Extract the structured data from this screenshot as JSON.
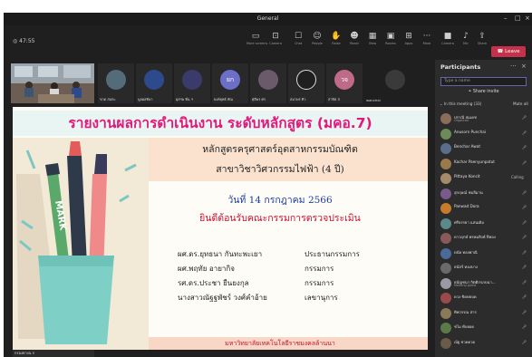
{
  "window": {
    "title": "General"
  },
  "toolbar": {
    "timer": "47:55",
    "buttons": [
      {
        "icon": "screen-icon",
        "label": "More screens"
      },
      {
        "icon": "camera-icon",
        "label": "Camera"
      },
      {
        "icon": "chat-icon",
        "label": "Chat"
      },
      {
        "icon": "people-icon",
        "label": "People"
      },
      {
        "icon": "raise-hand-icon",
        "label": "Raise"
      },
      {
        "icon": "react-icon",
        "label": "React"
      },
      {
        "icon": "view-icon",
        "label": "View"
      },
      {
        "icon": "rooms-icon",
        "label": "Rooms"
      },
      {
        "icon": "apps-icon",
        "label": "Apps"
      },
      {
        "icon": "more-icon",
        "label": "More"
      },
      {
        "icon": "camera-off-icon",
        "label": "Camera"
      },
      {
        "icon": "mic-icon",
        "label": "Mic"
      },
      {
        "icon": "share-icon",
        "label": "Share"
      }
    ],
    "leave_label": "Leave"
  },
  "video_tiles": [
    {
      "name": "ขวด สบตะ",
      "avatar_text": ""
    },
    {
      "name": "พูลผลทิพา",
      "avatar_text": ""
    },
    {
      "name": "ผุสฯพ ทิ่น ฯ",
      "avatar_text": ""
    },
    {
      "name": "ยงค์ยุทธ์ ทัณ",
      "avatar_text": "ยก"
    },
    {
      "name": "ศุลีพร ศร",
      "avatar_text": ""
    },
    {
      "name": "สมาพร ทิว",
      "avatar_text": ""
    },
    {
      "name": "สาธิต ส",
      "avatar_text": "วจ"
    },
    {
      "name": "wanchai",
      "avatar_text": ""
    }
  ],
  "slide": {
    "title": "รายงานผลการดำเนินงาน ระดับหลักสูตร (มคอ.7)",
    "line1": "หลักสูตรครุศาสตร์อุตสาหกรรมบัณฑิต",
    "line2": "สาขาวิชาวิศวกรรมไฟฟ้า (4 ปี)",
    "date": "วันที่ 14 กรกฎาคม 2566",
    "welcome": "ยินดีต้อนรับคณะกรรมการตรวจประเมิน",
    "committee": [
      {
        "name": "ผศ.ดร.ยุทธนา กันทะพะเยา",
        "role": "ประธานกรรมการ"
      },
      {
        "name": "ผศ.พฤทัย อายากิจ",
        "role": "กรรมการ"
      },
      {
        "name": "รศ.ดร.ประชา ยืนยงกุล",
        "role": "กรรมการ"
      },
      {
        "name": "นางสาวณัฐฐพัชร์ วงศ์คำอ้าย",
        "role": "เลขานุการ"
      }
    ],
    "footer": "มหาวิทยาลัยเทคโนโลยีราชมงคลล้านนา",
    "marker_text": "MARK"
  },
  "self_view_label": "กรองทางน ก",
  "panel": {
    "title": "Participants",
    "invite_placeholder": "Type a name",
    "share_invite": "Share invite",
    "section_label": "In this meeting (33)",
    "mute_all": "Mute all",
    "participants": [
      {
        "name": "ปราณี สมเดช",
        "sub": "Organizer",
        "color": "#8a6d5a",
        "tag": ""
      },
      {
        "name": "Anusorn Punchai",
        "sub": "",
        "color": "#6d8a5a",
        "tag": ""
      },
      {
        "name": "Benchar Awat",
        "sub": "",
        "color": "#5a6d8a",
        "tag": ""
      },
      {
        "name": "Kachar Paenyunpatut",
        "sub": "",
        "color": "#9a7a4a",
        "tag": ""
      },
      {
        "name": "Pittaya Koncit",
        "sub": "",
        "color": "#a58b6a",
        "tag": "Calling"
      },
      {
        "name": "สุกฤษณ์ ชมลีมาน",
        "sub": "",
        "color": "#7a5a8a",
        "tag": ""
      },
      {
        "name": "Panwad Dora",
        "sub": "",
        "color": "#c57b2b",
        "tag": ""
      },
      {
        "name": "ศรีจรรยา แสนเดิม",
        "sub": "",
        "color": "#5a8a8a",
        "tag": ""
      },
      {
        "name": "ดาวฤกษ์ พรหมสิงห์ ปีทอง",
        "sub": "",
        "color": "#8a5a5a",
        "tag": ""
      },
      {
        "name": "ดนัย ทองพาณิ",
        "sub": "",
        "color": "#4a6a9a",
        "tag": ""
      },
      {
        "name": "ธนัสร์ ทองบาง",
        "sub": "",
        "color": "#6a6a6a",
        "tag": ""
      },
      {
        "name": "ธนัญชนา กิตติกรภบนา...",
        "sub": "Meeting guest",
        "color": "#9a9aa5",
        "tag": ""
      },
      {
        "name": "ดวง ขิดตยบด",
        "sub": "",
        "color": "#9a4a4a",
        "tag": ""
      },
      {
        "name": "ทิพวรรณ สาร",
        "sub": "",
        "color": "#8a7a5a",
        "tag": ""
      },
      {
        "name": "ชไม ทับยอด",
        "sub": "",
        "color": "#5a7a4a",
        "tag": ""
      },
      {
        "name": "ณัฐ ชวดดวด",
        "sub": "",
        "color": "#6a5a4a",
        "tag": ""
      }
    ]
  }
}
